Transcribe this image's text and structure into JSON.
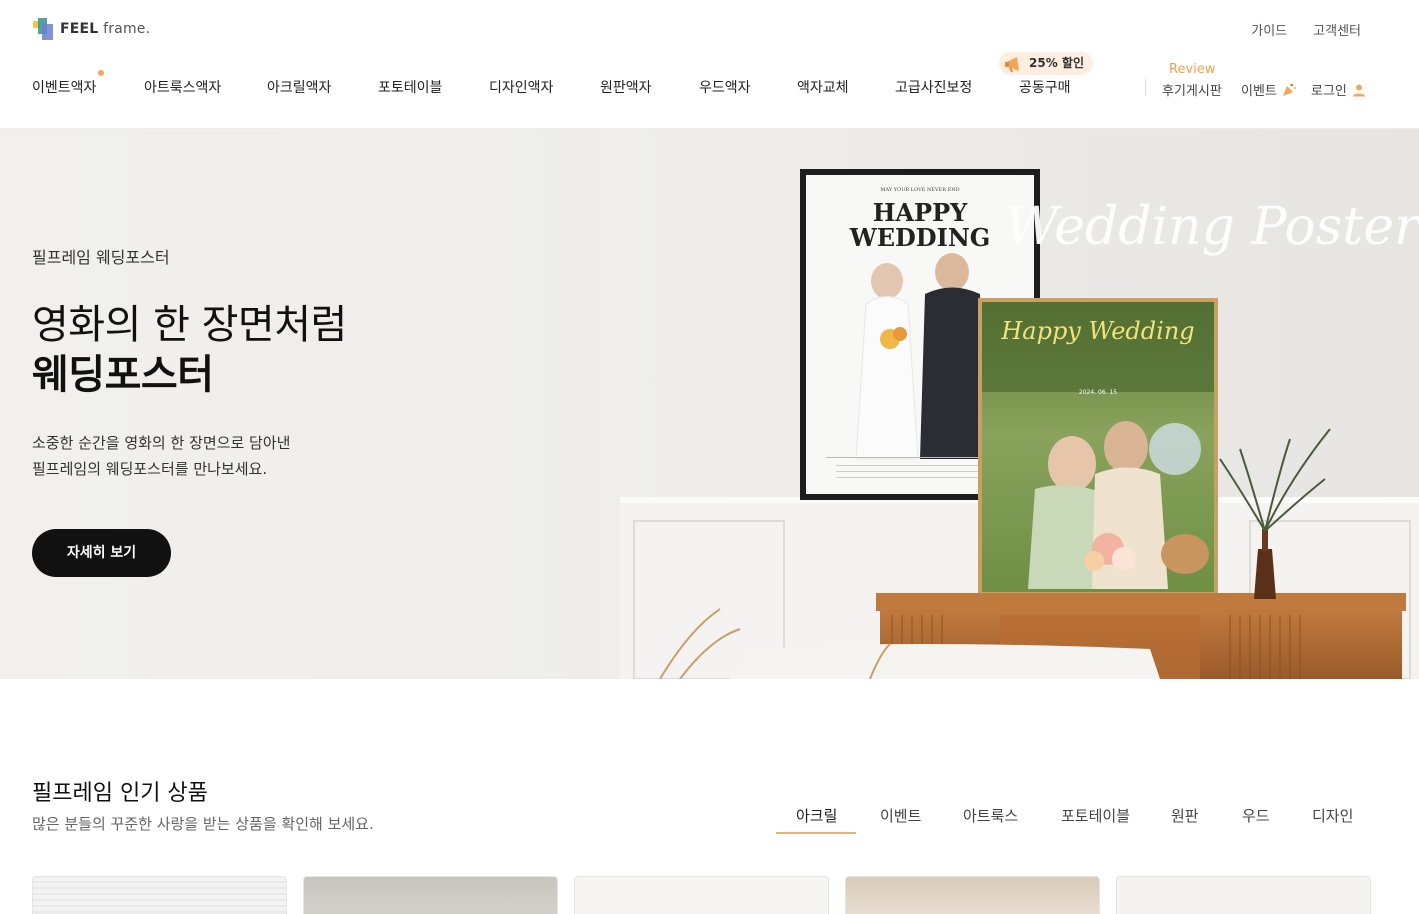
{
  "header": {
    "logo": {
      "brand": "FEEL",
      "suffix": "frame."
    },
    "util_links": [
      "가이드",
      "고객센터"
    ],
    "gnb": [
      {
        "label": "이벤트액자",
        "dot": true
      },
      {
        "label": "아트룩스액자"
      },
      {
        "label": "아크릴액자"
      },
      {
        "label": "포토테이블"
      },
      {
        "label": "디자인액자"
      },
      {
        "label": "원판액자"
      },
      {
        "label": "우드액자"
      },
      {
        "label": "액자교체"
      },
      {
        "label": "고급사진보정"
      },
      {
        "label": "공동구매"
      }
    ],
    "sale_badge": "25% 할인",
    "review_tag": "Review",
    "right_nav": {
      "review_board": "후기게시판",
      "event": "이벤트",
      "login": "로그인"
    }
  },
  "hero": {
    "subtitle": "필프레임 웨딩포스터",
    "title_line1": "영화의 한 장면처럼",
    "title_line2": "웨딩포스터",
    "desc_line1": "소중한 순간을 영화의 한 장면으로 담아낸",
    "desc_line2": "필프레임의 웨딩포스터를 만나보세요.",
    "button": "자세히 보기",
    "image_text": {
      "script_title": "Wedding Poster",
      "poster1_small": "MAY YOUR LOVE NEVER END",
      "poster1_title_1": "HAPPY",
      "poster1_title_2": "WEDDING",
      "poster2_title": "Happy Wedding",
      "poster2_date": "2024. 06. 15"
    }
  },
  "popular": {
    "title": "필프레임 인기 상품",
    "desc": "많은 분들의 꾸준한 사랑을 받는 상품을 확인해 보세요.",
    "tabs": [
      "아크릴",
      "이벤트",
      "아트룩스",
      "포토테이블",
      "원판",
      "우드",
      "디자인"
    ],
    "active_tab": "아크릴"
  },
  "colors": {
    "accent": "#f2a657",
    "review": "#f0a050",
    "badge_bg": "#fdeee0",
    "button_bg": "#111111",
    "tab_underline": "#e8b07a"
  }
}
